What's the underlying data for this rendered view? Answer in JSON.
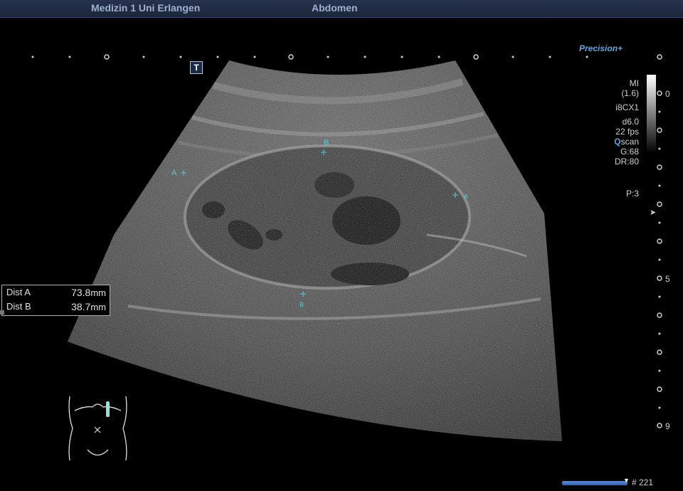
{
  "header": {
    "institution": "Medizin 1 Uni Erlangen",
    "exam": "Abdomen"
  },
  "brand": {
    "processing": "Precision+"
  },
  "marker": {
    "label": "T"
  },
  "acquisition": {
    "mi_label": "MI",
    "mi_value": "(1.6)",
    "probe": "i8CX1",
    "depth": "d6.0",
    "frame_rate": "22 fps",
    "qscan_q": "Q",
    "qscan_rest": "scan",
    "gain": "G:68",
    "dynamic_range": "DR:80",
    "power": "P:3"
  },
  "depth_scale": {
    "top": "0",
    "mid": "5",
    "bottom": "9"
  },
  "measurements": [
    {
      "label": "Dist A",
      "value": "73.8",
      "unit": "mm"
    },
    {
      "label": "Dist B",
      "value": "38.7",
      "unit": "mm"
    }
  ],
  "calipers": {
    "a": "A",
    "b": "B"
  },
  "cine": {
    "frame": "# 221"
  },
  "colors": {
    "accent": "#5fa8d8",
    "caliper": "#4fd0d8",
    "header_bg": "#1b2539"
  }
}
